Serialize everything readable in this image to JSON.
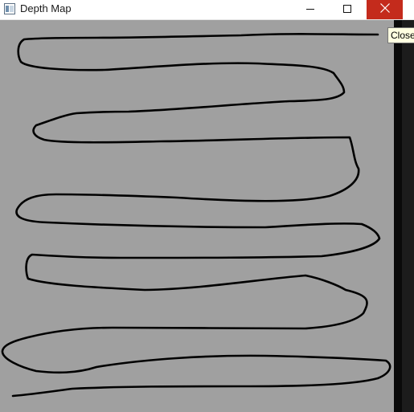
{
  "window": {
    "title": "Depth Map",
    "app_icon": "window-app-icon",
    "controls": {
      "minimize_icon": "minimize-icon",
      "maximize_icon": "maximize-icon",
      "close_icon": "close-icon",
      "close_color": "#c42b1c"
    }
  },
  "tooltip": {
    "text": "Close"
  },
  "canvas": {
    "background_color": "#a0a0a0",
    "stroke_color": "#000000"
  }
}
